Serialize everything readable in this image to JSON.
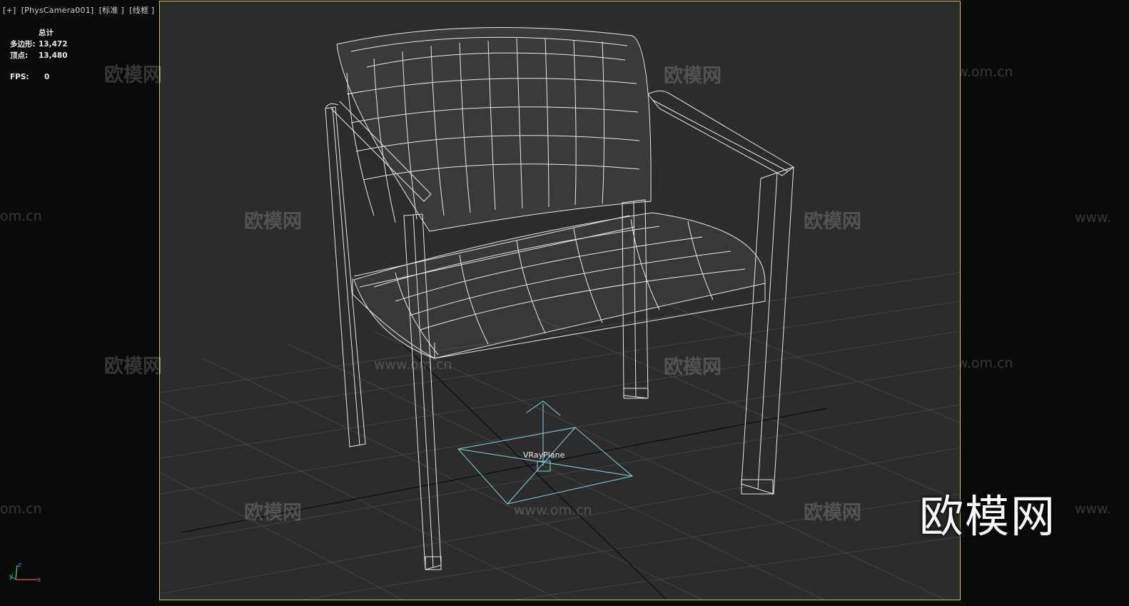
{
  "viewport": {
    "label": "[+]  [PhysCamera001]  [标准 ]  [线框 ]",
    "frame_color": "#c8c832",
    "background": "#2c2c2c"
  },
  "stats": {
    "total_label": "总计",
    "polygons_label": "多边形:",
    "polygons_value": "13,472",
    "vertices_label": "顶点:",
    "vertices_value": "13,480",
    "fps_label": "FPS:",
    "fps_value": "0"
  },
  "scene": {
    "object_label": "VRayPlane",
    "wireframe_color": "#e8e8e8",
    "helper_color": "#7fd4dc"
  },
  "watermark": {
    "cn": "欧模网",
    "url": "www.om.cn",
    "url_short": "www.",
    "url_tail": "om.cn",
    "logo": "欧模网"
  },
  "axis_gizmo": {
    "x": "x",
    "y": "y",
    "z": "z"
  }
}
